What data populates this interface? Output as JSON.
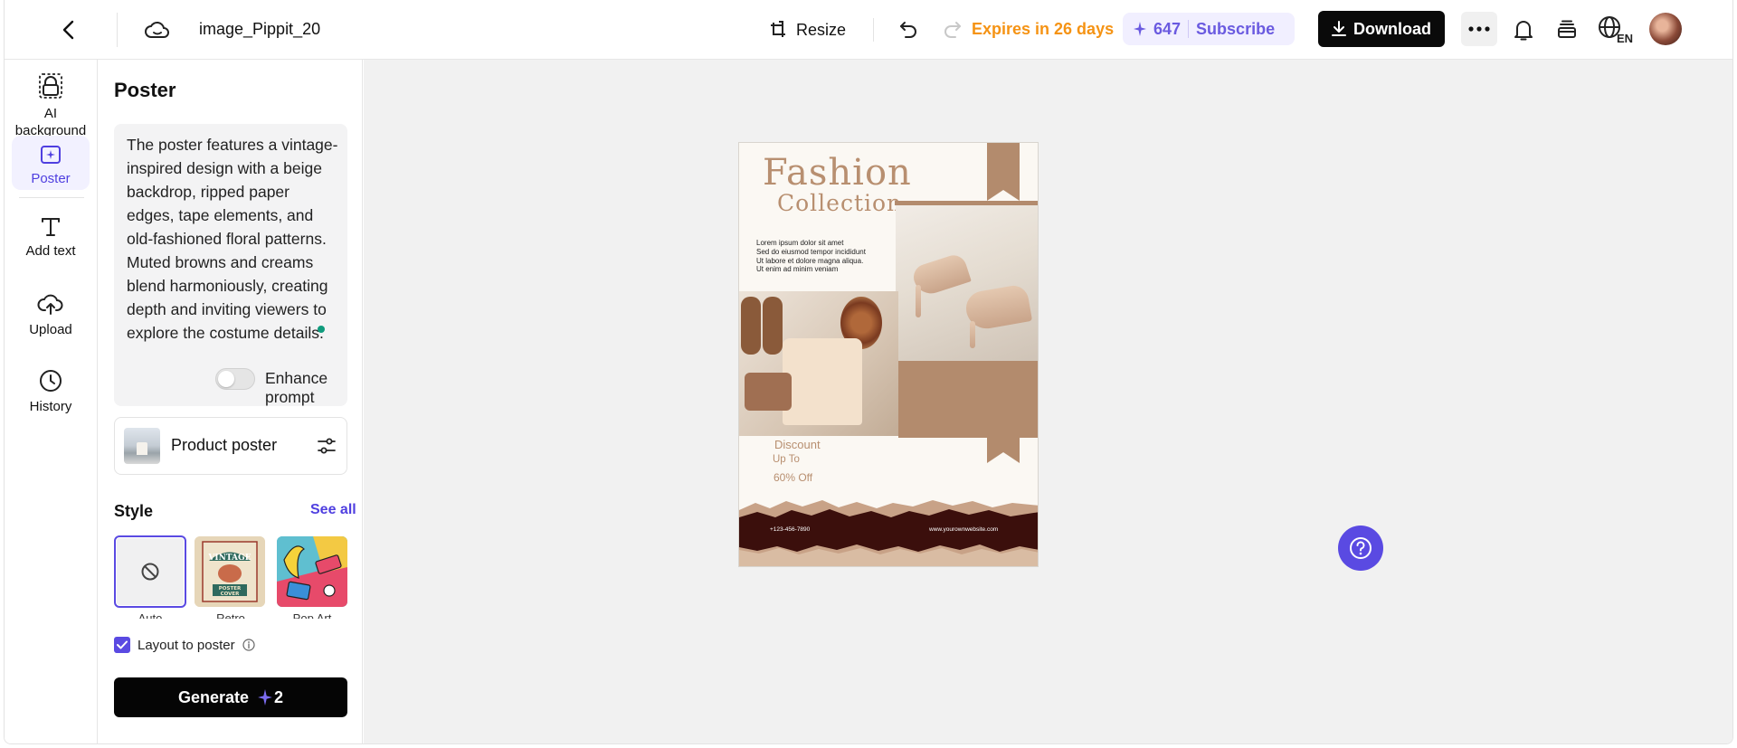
{
  "topbar": {
    "file_name": "image_Pippit_20",
    "resize_label": "Resize",
    "expires_text": "Expires in 26 days",
    "credits": "647",
    "subscribe_label": "Subscribe",
    "download_label": "Download",
    "language_code": "EN"
  },
  "rail": {
    "items": [
      {
        "label": "AI background",
        "icon": "ai-background-icon"
      },
      {
        "label": "Poster",
        "icon": "poster-icon"
      },
      {
        "label": "Add text",
        "icon": "text-icon"
      },
      {
        "label": "Upload",
        "icon": "upload-cloud-icon"
      },
      {
        "label": "History",
        "icon": "clock-icon"
      }
    ]
  },
  "panel": {
    "title": "Poster",
    "prompt": "The poster features a vintage-inspired design with a beige backdrop, ripped paper edges, tape elements, and old-fashioned floral patterns. Muted browns and creams blend harmoniously, creating depth and inviting viewers to explore the costume details.",
    "enhance_prompt_label": "Enhance prompt",
    "enhance_prompt_on": false,
    "product_label": "Product poster",
    "style_label": "Style",
    "see_all_label": "See all",
    "styles": [
      {
        "label": "Auto",
        "selected": true
      },
      {
        "label": "Retro",
        "selected": false
      },
      {
        "label": "Pop Art",
        "selected": false
      }
    ],
    "retro_card": {
      "line1": "VINTAGE",
      "line2": "POSTER",
      "line3": "COVER"
    },
    "layout_to_poster_label": "Layout to poster",
    "layout_to_poster_checked": true,
    "generate_label": "Generate",
    "generate_cost": "2"
  },
  "poster": {
    "title1": "Fashion",
    "title2": "Collection",
    "lorem": [
      "Lorem ipsum dolor sit amet",
      "Sed do eiusmod tempor incididunt",
      "Ut labore et dolore magna aliqua.",
      "Ut enim ad minim veniam"
    ],
    "discount": "Discount",
    "up_to": "Up To",
    "off": "60% Off",
    "phone": "+123-456-7890",
    "website": "www.yourownwebsite.com"
  },
  "colors": {
    "accent": "#5a4ae2",
    "expires": "#f59314",
    "poster_brown": "#b38b6d",
    "poster_text": "#b88f70"
  }
}
